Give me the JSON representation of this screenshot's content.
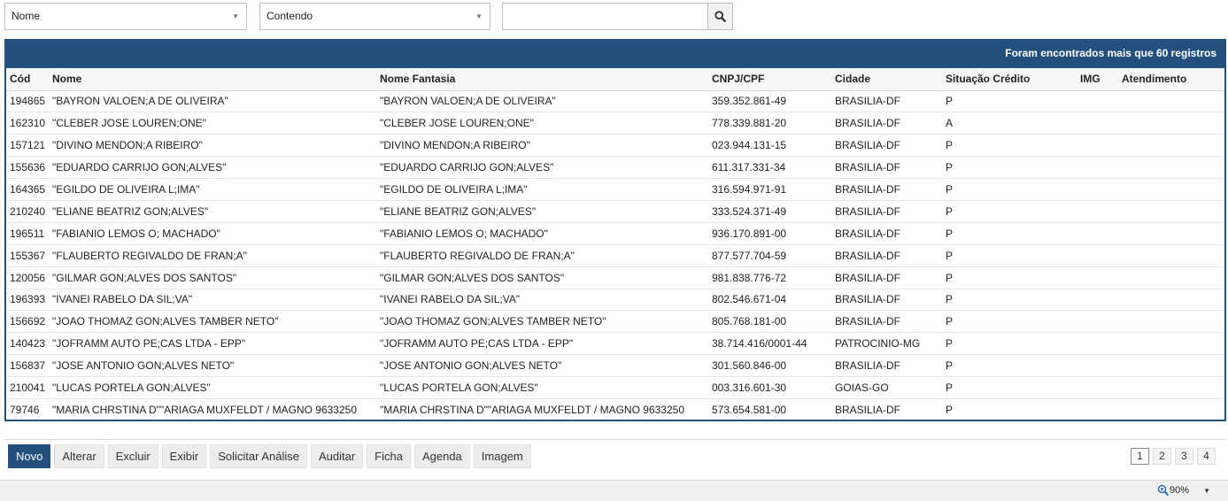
{
  "search": {
    "field_value": "Nome",
    "operator_value": "Contendo",
    "text_value": ""
  },
  "grid": {
    "banner": "Foram encontrados mais que 60 registros",
    "columns": [
      "Cód",
      "Nome",
      "Nome Fantasia",
      "CNPJ/CPF",
      "Cidade",
      "Situação Crédito",
      "IMG",
      "Atendimento"
    ],
    "rows": [
      [
        "194865",
        "\"BAYRON VALOEN;A DE OLIVEIRA\"",
        "\"BAYRON VALOEN;A DE OLIVEIRA\"",
        "359.352.861-49",
        "BRASILIA-DF",
        "P",
        "",
        ""
      ],
      [
        "162310",
        "\"CLEBER JOSE LOUREN;ONE\"",
        "\"CLEBER JOSE LOUREN;ONE\"",
        "778.339.881-20",
        "BRASILIA-DF",
        "A",
        "",
        ""
      ],
      [
        "157121",
        "\"DIVINO MENDON;A RIBEIRO\"",
        "\"DIVINO MENDON;A RIBEIRO\"",
        "023.944.131-15",
        "BRASILIA-DF",
        "P",
        "",
        ""
      ],
      [
        "155636",
        "\"EDUARDO CARRIJO GON;ALVES\"",
        "\"EDUARDO CARRIJO GON;ALVES\"",
        "611.317.331-34",
        "BRASILIA-DF",
        "P",
        "",
        ""
      ],
      [
        "164365",
        "\"EGILDO DE OLIVEIRA L;IMA\"",
        "\"EGILDO DE OLIVEIRA L;IMA\"",
        "316.594.971-91",
        "BRASILIA-DF",
        "P",
        "",
        ""
      ],
      [
        "210240",
        "\"ELIANE BEATRIZ GON;ALVES\"",
        "\"ELIANE BEATRIZ GON;ALVES\"",
        "333.524.371-49",
        "BRASILIA-DF",
        "P",
        "",
        ""
      ],
      [
        "196511",
        "\"FABIANIO LEMOS O; MACHADO\"",
        "\"FABIANIO LEMOS O; MACHADO\"",
        "936.170.891-00",
        "BRASILIA-DF",
        "P",
        "",
        ""
      ],
      [
        "155367",
        "\"FLAUBERTO REGIVALDO DE FRAN;A\"",
        "\"FLAUBERTO REGIVALDO DE FRAN;A\"",
        "877.577.704-59",
        "BRASILIA-DF",
        "P",
        "",
        ""
      ],
      [
        "120056",
        "\"GILMAR GON;ALVES DOS SANTOS\"",
        "\"GILMAR GON;ALVES DOS SANTOS\"",
        "981.838.776-72",
        "BRASILIA-DF",
        "P",
        "",
        ""
      ],
      [
        "196393",
        "\"IVANEI RABELO DA SIL;VA\"",
        "\"IVANEI RABELO DA SIL;VA\"",
        "802.546.671-04",
        "BRASILIA-DF",
        "P",
        "",
        ""
      ],
      [
        "156692",
        "\"JOAO THOMAZ GON;ALVES TAMBER NETO\"",
        "\"JOAO THOMAZ GON;ALVES TAMBER NETO\"",
        "805.768.181-00",
        "BRASILIA-DF",
        "P",
        "",
        ""
      ],
      [
        "140423",
        "\"JOFRAMM AUTO PE;CAS LTDA - EPP\"",
        "\"JOFRAMM AUTO PE;CAS LTDA - EPP\"",
        "38.714.416/0001-44",
        "PATROCINIO-MG",
        "P",
        "",
        ""
      ],
      [
        "156837",
        "\"JOSE ANTONIO GON;ALVES NETO\"",
        "\"JOSE ANTONIO GON;ALVES NETO\"",
        "301.560.846-00",
        "BRASILIA-DF",
        "P",
        "",
        ""
      ],
      [
        "210041",
        "\"LUCAS PORTELA GON;ALVES\"",
        "\"LUCAS PORTELA GON;ALVES\"",
        "003.316.601-30",
        "GOIAS-GO",
        "P",
        "",
        ""
      ],
      [
        "79746",
        "\"MARIA CHRSTINA D\"\"ARIAGA MUXFELDT / MAGNO 9633250",
        "\"MARIA CHRSTINA D\"\"ARIAGA MUXFELDT / MAGNO 9633250",
        "573.654.581-00",
        "BRASILIA-DF",
        "P",
        "",
        ""
      ]
    ]
  },
  "actions": [
    "Novo",
    "Alterar",
    "Excluir",
    "Exibir",
    "Solicitar Análise",
    "Auditar",
    "Ficha",
    "Agenda",
    "Imagem"
  ],
  "pagination": {
    "pages": [
      "1",
      "2",
      "3",
      "4"
    ],
    "current": "1"
  },
  "status": {
    "zoom": "90%"
  },
  "colors": {
    "accent": "#24507e"
  }
}
